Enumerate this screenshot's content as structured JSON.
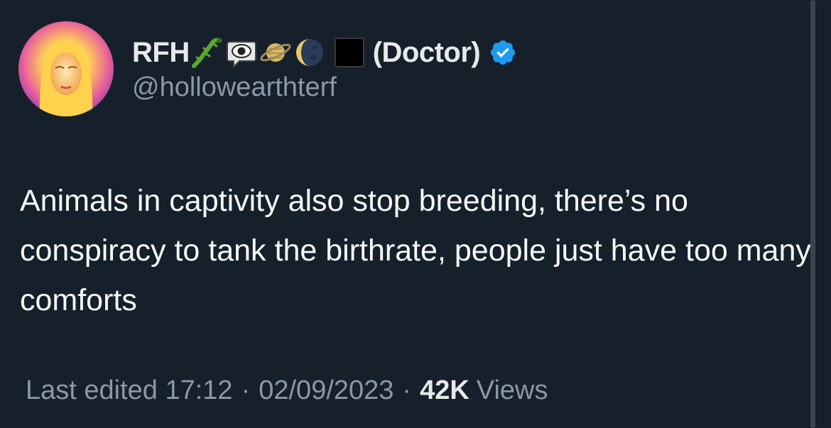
{
  "author": {
    "display_name": "RFH",
    "emojis": [
      "lizard-icon",
      "eye-in-speech-bubble-icon",
      "ringed-planet-icon",
      "waning-moon-icon",
      "black-square-icon"
    ],
    "title": "(Doctor)",
    "verified": true,
    "handle": "@hollowearthterf"
  },
  "tweet": {
    "text": "Animals in captivity also stop breeding, there’s no conspiracy to tank the birthrate, people just have too many comforts"
  },
  "meta": {
    "edited_label": "Last edited 17:12",
    "separator": "·",
    "date": "02/09/2023",
    "views_count": "42K",
    "views_label": "Views"
  },
  "colors": {
    "background": "#15202b",
    "text_primary": "#e7e9ea",
    "text_secondary": "#8b98a5",
    "verified_blue": "#1d9bf0"
  }
}
